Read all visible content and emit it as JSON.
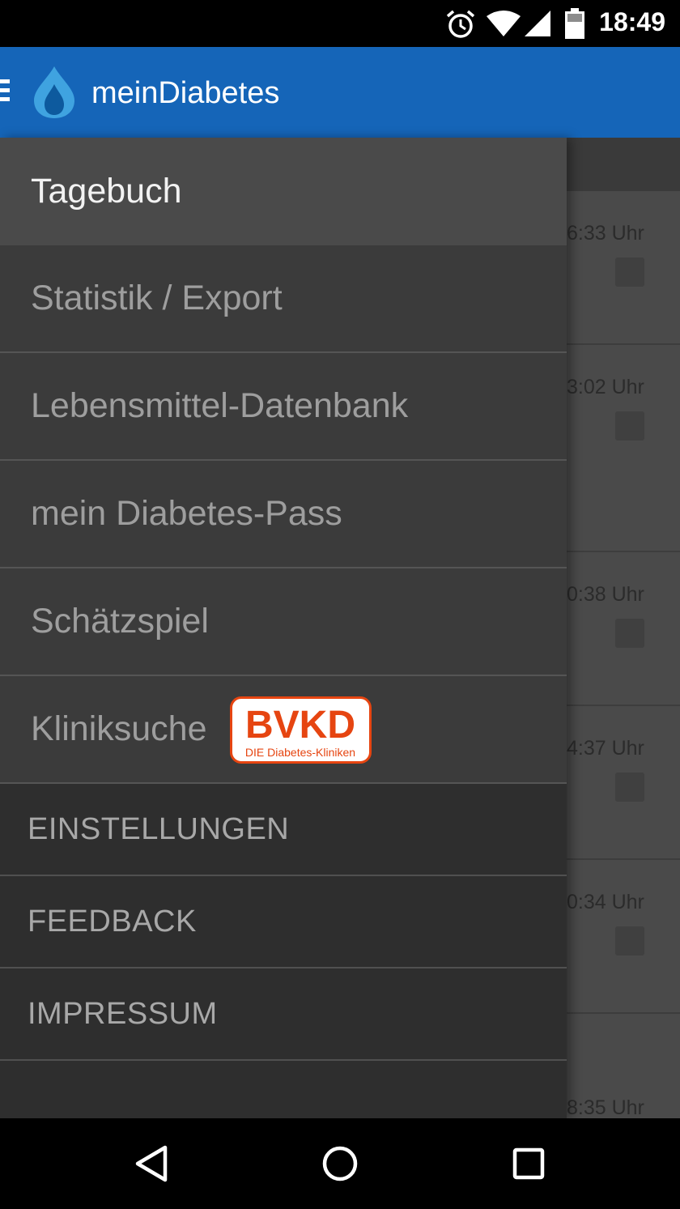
{
  "status_bar": {
    "time": "18:49",
    "icons": [
      "alarm-icon",
      "wifi-icon",
      "cell-signal-icon",
      "battery-icon"
    ]
  },
  "app_bar": {
    "title": "meinDiabetes",
    "menu_icon": "hamburger-icon",
    "logo_icon": "water-drop-icon"
  },
  "drawer": {
    "items": [
      {
        "label": "Tagebuch",
        "active": true
      },
      {
        "label": "Statistik / Export"
      },
      {
        "label": "Lebensmittel-Datenbank"
      },
      {
        "label": "mein Diabetes-Pass"
      },
      {
        "label": "Schätzspiel"
      },
      {
        "label": "Kliniksuche"
      }
    ],
    "badge": {
      "logo_text": "BVKD",
      "caption": "DIE Diabetes-Kliniken"
    },
    "sections": [
      {
        "label": "EINSTELLUNGEN"
      },
      {
        "label": "FEEDBACK"
      },
      {
        "label": "IMPRESSUM"
      }
    ]
  },
  "background_entries": [
    {
      "time": "6:33 Uhr"
    },
    {
      "time": "3:02 Uhr"
    },
    {
      "time": "0:38 Uhr"
    },
    {
      "time": "4:37 Uhr"
    },
    {
      "time": "0:34 Uhr"
    },
    {
      "time": "8:35 Uhr"
    }
  ],
  "nav_bar": {
    "icons": [
      "back-icon",
      "home-icon",
      "recents-icon"
    ]
  },
  "colors": {
    "app_bar": "#1565b8",
    "drawer_bg": "#3b3b3b",
    "drawer_active": "#4a4a4a",
    "badge_accent": "#e64511"
  }
}
